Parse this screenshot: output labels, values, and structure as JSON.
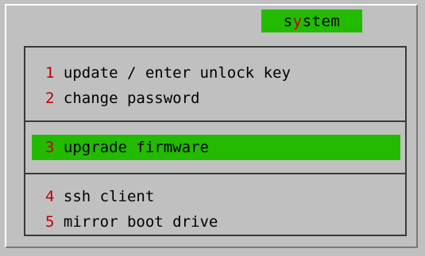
{
  "window": {
    "title_prefix": "s",
    "title_hotkey": "y",
    "title_suffix": "stem"
  },
  "menu": {
    "items": [
      {
        "key": "1",
        "label": "update / enter unlock key"
      },
      {
        "key": "2",
        "label": "change password"
      },
      {
        "key": "3",
        "label": "upgrade firmware",
        "selected": true
      },
      {
        "key": "4",
        "label": "ssh client"
      },
      {
        "key": "5",
        "label": "mirror boot drive"
      }
    ]
  },
  "colors": {
    "background": "#c0c0c0",
    "highlight": "#22bb00",
    "hotkey": "#c00000",
    "text": "#000000"
  }
}
